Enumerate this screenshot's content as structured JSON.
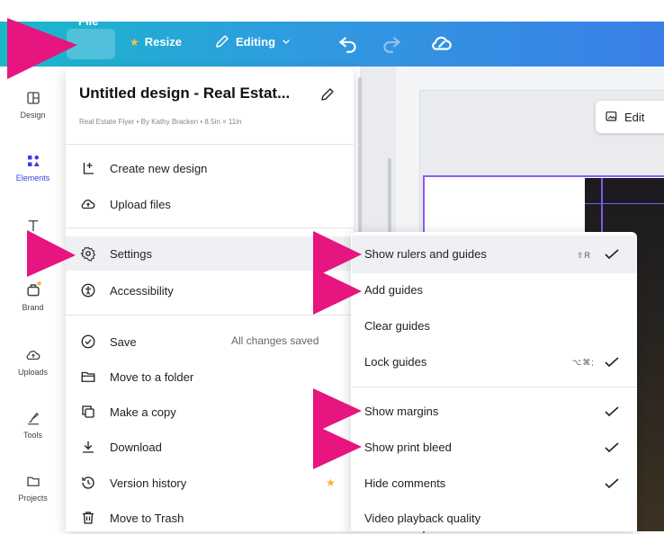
{
  "topbar": {
    "file_label": "File",
    "resize_label": "Resize",
    "editing_label": "Editing"
  },
  "rail": [
    {
      "label": "Design",
      "icon": "design-icon"
    },
    {
      "label": "Elements",
      "icon": "elements-icon"
    },
    {
      "label": "Text",
      "icon": "text-icon"
    },
    {
      "label": "Brand",
      "icon": "brand-icon"
    },
    {
      "label": "Uploads",
      "icon": "uploads-icon"
    },
    {
      "label": "Tools",
      "icon": "tools-icon"
    },
    {
      "label": "Projects",
      "icon": "projects-icon"
    }
  ],
  "canvas": {
    "edit_label": "Edit"
  },
  "file_menu": {
    "title": "Untitled design - Real Estat...",
    "subtitle": "Real Estate Flyer • By Kathy Bracken • 8.5in × 11in",
    "items": [
      {
        "label": "Create new design",
        "icon": "create-icon"
      },
      {
        "label": "Upload files",
        "icon": "upload-cloud-icon"
      },
      {
        "label": "Settings",
        "icon": "gear-icon"
      },
      {
        "label": "Accessibility",
        "icon": "accessibility-icon"
      },
      {
        "label": "Save",
        "icon": "check-circle-icon"
      },
      {
        "label": "Move to a folder",
        "icon": "folder-icon"
      },
      {
        "label": "Make a copy",
        "icon": "copy-icon"
      },
      {
        "label": "Download",
        "icon": "download-icon"
      },
      {
        "label": "Version history",
        "icon": "history-icon"
      },
      {
        "label": "Move to Trash",
        "icon": "trash-icon"
      }
    ],
    "save_status": "All changes saved"
  },
  "settings_submenu": {
    "items": [
      {
        "label": "Show rulers and guides",
        "shortcut": "⇧R",
        "checked": true
      },
      {
        "label": "Add guides",
        "shortcut": "",
        "checked": false
      },
      {
        "label": "Clear guides",
        "shortcut": "",
        "checked": false
      },
      {
        "label": "Lock guides",
        "shortcut": "⌥⌘;",
        "checked": true
      },
      {
        "label": "Show margins",
        "shortcut": "",
        "checked": true
      },
      {
        "label": "Show print bleed",
        "shortcut": "",
        "checked": true
      },
      {
        "label": "Hide comments",
        "shortcut": "",
        "checked": true
      },
      {
        "label": "Video playback quality",
        "shortcut": "",
        "checked": false
      }
    ]
  },
  "colors": {
    "accent_arrow": "#e6157f",
    "brand_purple": "#8b5cf6",
    "topbar_start": "#19b8c9",
    "topbar_end": "#3a7fe6"
  }
}
